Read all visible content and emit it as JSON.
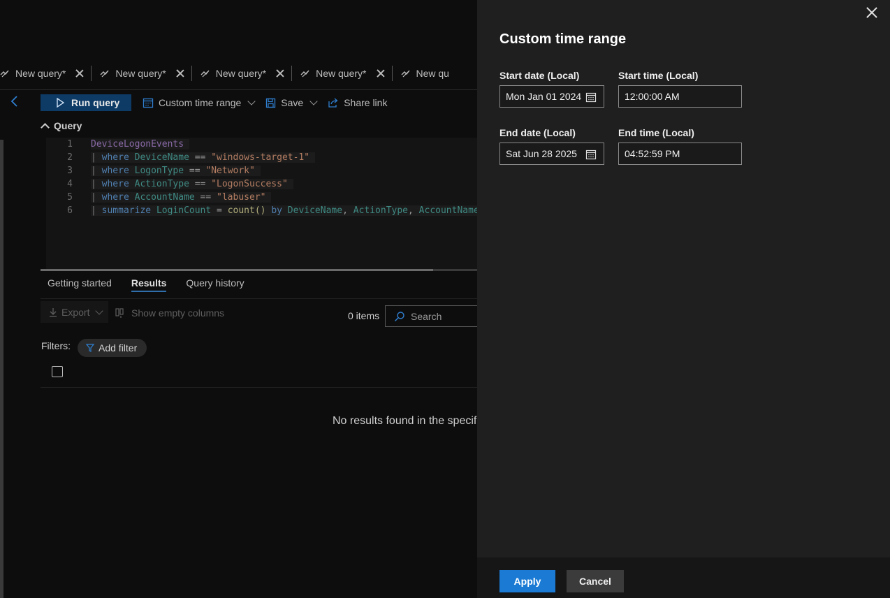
{
  "query_tabs": [
    {
      "label": "New query*"
    },
    {
      "label": "New query*"
    },
    {
      "label": "New query*"
    },
    {
      "label": "New query*"
    },
    {
      "label": "New qu"
    }
  ],
  "toolbar": {
    "run_query": "Run query",
    "time_range": "Custom time range",
    "save": "Save",
    "share_link": "Share link"
  },
  "query_section": {
    "title": "Query",
    "lines": [
      {
        "num": "1",
        "tokens": [
          [
            "table",
            "DeviceLogonEvents"
          ]
        ]
      },
      {
        "num": "2",
        "tokens": [
          [
            "pipe",
            "| "
          ],
          [
            "kw",
            "where "
          ],
          [
            "fld",
            "DeviceName "
          ],
          [
            "op",
            "== "
          ],
          [
            "str",
            "\"windows-target-1\""
          ]
        ]
      },
      {
        "num": "3",
        "tokens": [
          [
            "pipe",
            "| "
          ],
          [
            "kw",
            "where "
          ],
          [
            "fld",
            "LogonType "
          ],
          [
            "op",
            "== "
          ],
          [
            "str",
            "\"Network\""
          ]
        ]
      },
      {
        "num": "4",
        "tokens": [
          [
            "pipe",
            "| "
          ],
          [
            "kw",
            "where "
          ],
          [
            "fld",
            "ActionType "
          ],
          [
            "op",
            "== "
          ],
          [
            "str",
            "\"LogonSuccess\""
          ]
        ]
      },
      {
        "num": "5",
        "tokens": [
          [
            "pipe",
            "| "
          ],
          [
            "kw",
            "where "
          ],
          [
            "fld",
            "AccountName "
          ],
          [
            "op",
            "== "
          ],
          [
            "str",
            "\"labuser\""
          ]
        ]
      },
      {
        "num": "6",
        "tokens": [
          [
            "pipe",
            "| "
          ],
          [
            "kw",
            "summarize "
          ],
          [
            "fld",
            "LoginCount "
          ],
          [
            "op",
            "= "
          ],
          [
            "fn",
            "count() "
          ],
          [
            "kw",
            "by "
          ],
          [
            "fld",
            "DeviceName"
          ],
          [
            "op",
            ", "
          ],
          [
            "fld",
            "ActionType"
          ],
          [
            "op",
            ", "
          ],
          [
            "fld",
            "AccountName"
          ],
          [
            "op",
            ","
          ]
        ]
      }
    ]
  },
  "results": {
    "tabs": [
      "Getting started",
      "Results",
      "Query history"
    ],
    "active_tab": "Results",
    "export": "Export",
    "show_empty_columns": "Show empty columns",
    "items_count": "0 items",
    "search_placeholder": "Search",
    "filters_label": "Filters:",
    "add_filter": "Add filter",
    "no_results": "No results found in the specif"
  },
  "panel": {
    "title": "Custom time range",
    "start_date_label": "Start date (Local)",
    "start_date_value": "Mon Jan 01 2024",
    "start_time_label": "Start time (Local)",
    "start_time_value": "12:00:00 AM",
    "end_date_label": "End date (Local)",
    "end_date_value": "Sat Jun 28 2025",
    "end_time_label": "End time (Local)",
    "end_time_value": "04:52:59 PM",
    "apply": "Apply",
    "cancel": "Cancel"
  },
  "colors": {
    "accent": "#1a7ad4",
    "run_button": "#0e3a66",
    "panel_bg": "#1f1f1f"
  }
}
